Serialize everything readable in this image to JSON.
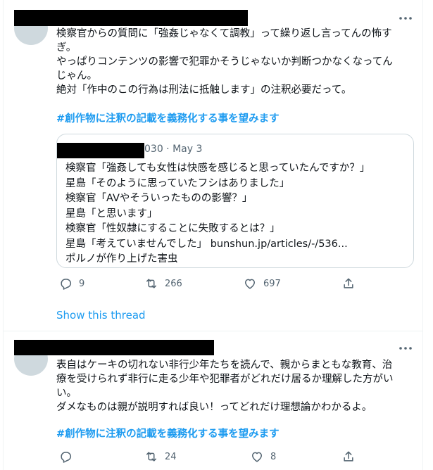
{
  "tweets": [
    {
      "text": "検察官からの質問に「強姦じゃなくて調教」って繰り返し言ってんの怖す\nぎ。\nやっぱりコンテンツの影響で犯罪かそうじゃないか判断つかなくなってん\nじゃん。\n絶対「作中のこの行為は刑法に抵触します」の注釈必要だって。",
      "hashtag": "#創作物に注釈の記載を義務化する事を望みます",
      "quote": {
        "meta": "030 · May 3",
        "text": "検察官「強姦しても女性は快感を感じると思っていたんですか？」\n星島「そのように思っていたフシはありました」\n検察官「AVやそういったものの影響？」\n星島「と思います」\n検察官「性奴隷にすることに失敗するとは？」\n星島「考えていませんでした」 bunshun.jp/articles/-/536...\nポルノが作り上げた害虫"
      },
      "replies": "9",
      "retweets": "266",
      "likes": "697",
      "show_thread": "Show this thread"
    },
    {
      "text": "表自はケーキの切れない非行少年たちを読んで、親からまともな教育、治\n療を受けられず非行に走る少年や犯罪者がどれだけ居るか理解した方がい\nい。\nダメなものは親が説明すれば良い！ってどれだけ理想論かわかるよ。",
      "hashtag": "#創作物に注釈の記載を義務化する事を望みます",
      "replies": "",
      "retweets": "24",
      "likes": "8"
    }
  ],
  "icons": {
    "more": "more-horizontal-icon",
    "reply": "reply-icon",
    "retweet": "retweet-icon",
    "like": "heart-icon",
    "share": "share-icon"
  },
  "colors": {
    "accent": "#1d9bf0",
    "secondary_text": "#536471",
    "border": "#cfd9de"
  }
}
